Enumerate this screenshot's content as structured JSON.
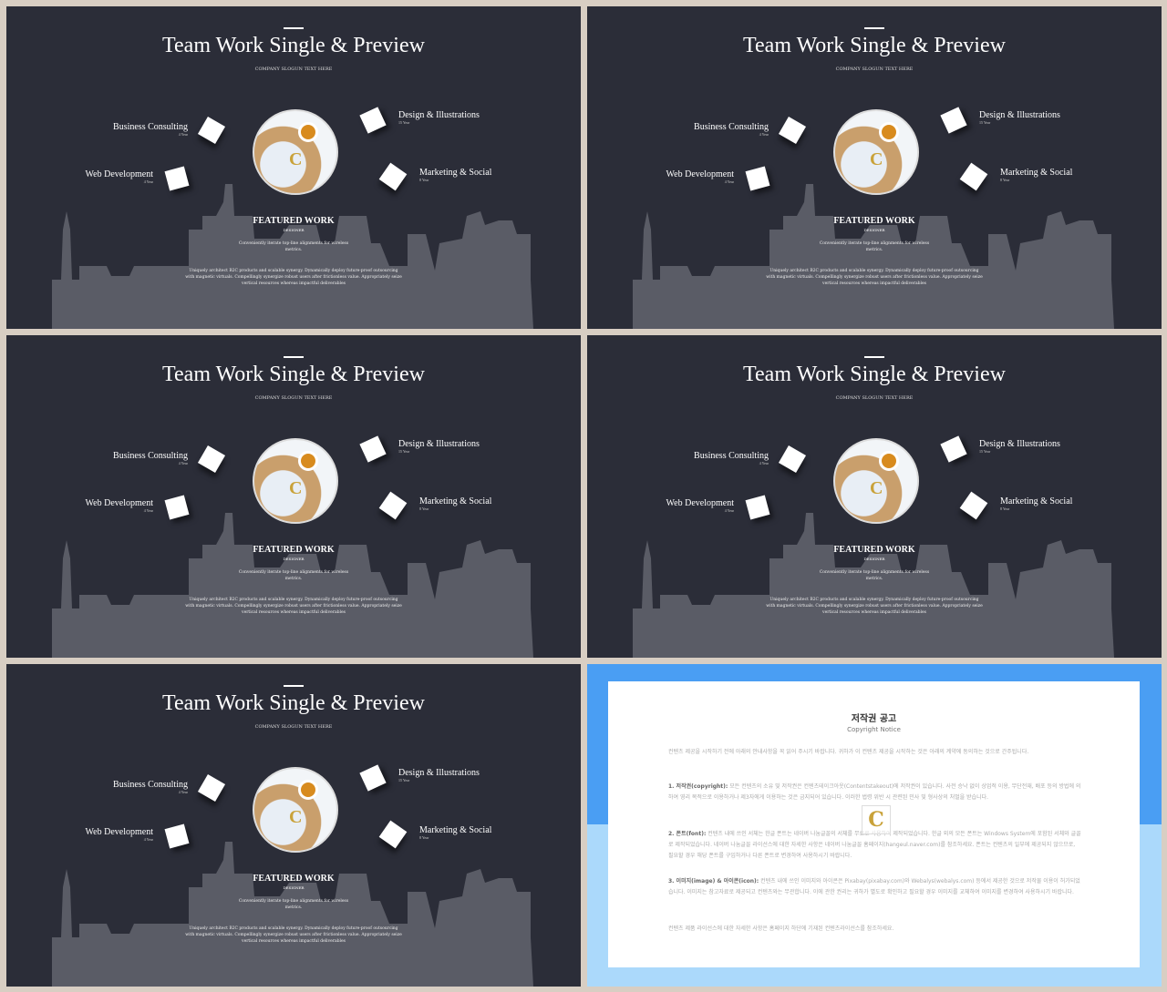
{
  "slide": {
    "title": "Team Work Single & Preview",
    "slogan": "COMPANY SLOGUN TEXT HERE",
    "skills": [
      {
        "label": "Business Consulting",
        "years": "4 Year"
      },
      {
        "label": "Web Development",
        "years": "4 Year"
      },
      {
        "label": "Design & Illustrations",
        "years": "15 Year"
      },
      {
        "label": "Marketing & Social",
        "years": "8 Year"
      }
    ],
    "featured": "FEATURED WORK",
    "role": "DESIGNER",
    "para1": "Conveniently iterate top-line alignments for wireless metrics.",
    "para2": "Uniquely architect B2C products and scalable synergy. Dynamically deploy future-proof outsourcing with magnetic virtuals. Compellingly synergize robust users after frictionless value. Appropriately seize vertical resources whereas impactful deliverables",
    "logo_text": "C"
  },
  "colors": {
    "slide_bg": "#2b2d38",
    "skyline": "#5a5c66",
    "copyright_blue": "#4a9ef3",
    "copyright_light": "#abd9fb"
  },
  "copyright": {
    "title": "저작권 공고",
    "subtitle": "Copyright Notice",
    "intro": "컨텐츠 제공을 시작하기 전에 아래의 안내사항을 꼭 읽어 주시기 바랍니다. 귀하가 이 컨텐츠 제공을 시작하는 것은 아래의 계약에 동의하는 것으로 간주됩니다.",
    "items": [
      {
        "head": "1. 저작권(copyright):",
        "body": "모든 컨텐츠의 소유 및 저작권은 컨텐츠테이크아웃(Contentstakeout)에 저작권이 있습니다. 사전 승낙 없이 상업적 이용, 무단전재, 배포 등의 방법에 의하여 영리 목적으로 이용하거나 제3자에게 이용하는 것은 금지되어 있습니다. 이러한 법령 위반 시 관련된 민사 및 형사상의 처벌을 받습니다."
      },
      {
        "head": "2. 폰트(font):",
        "body": "컨텐츠 내에 쓰인 서체는 한글 폰트는 네이버 나눔글꼴의 서체를 무료로 사용하여 제작되었습니다. 한글 외의 모든 폰트는 Windows System에 포함된 서체와 글꼴로 제작되었습니다. 네이버 나눔글꼴 라이선스에 대한 자세한 사항은 네이버 나눔글꼴 홈페이지(hangeul.naver.com)를 참조하세요. 폰트는 컨텐츠의 일부에 제공되지 않으므로, 필요할 경우 해당 폰트를 구입하거나 다른 폰트로 변경하여 사용하시기 바랍니다."
      },
      {
        "head": "3. 이미지(image) & 아이콘(icon):",
        "body": "컨텐츠 내에 쓰인 이미지와 아이콘은 Pixabay(pixabay.com)와 Webalys(webalys.com) 등에서 제공한 것으로 저작물 이용이 허가되었습니다. 이미지는 참고자료로 제공되고 컨텐츠와는 무관합니다. 이에 관한 권리는 귀하가 별도로 확인하고 필요할 경우 이미지를 교체하여 이미지를 변경하여 사용하시기 바랍니다."
      }
    ],
    "footer": "컨텐츠 제품 라이선스에 대한 자세한 사항은 홈페이지 하단에 기재된 컨텐츠라이선스를 참조하세요.",
    "watermark": "C"
  }
}
